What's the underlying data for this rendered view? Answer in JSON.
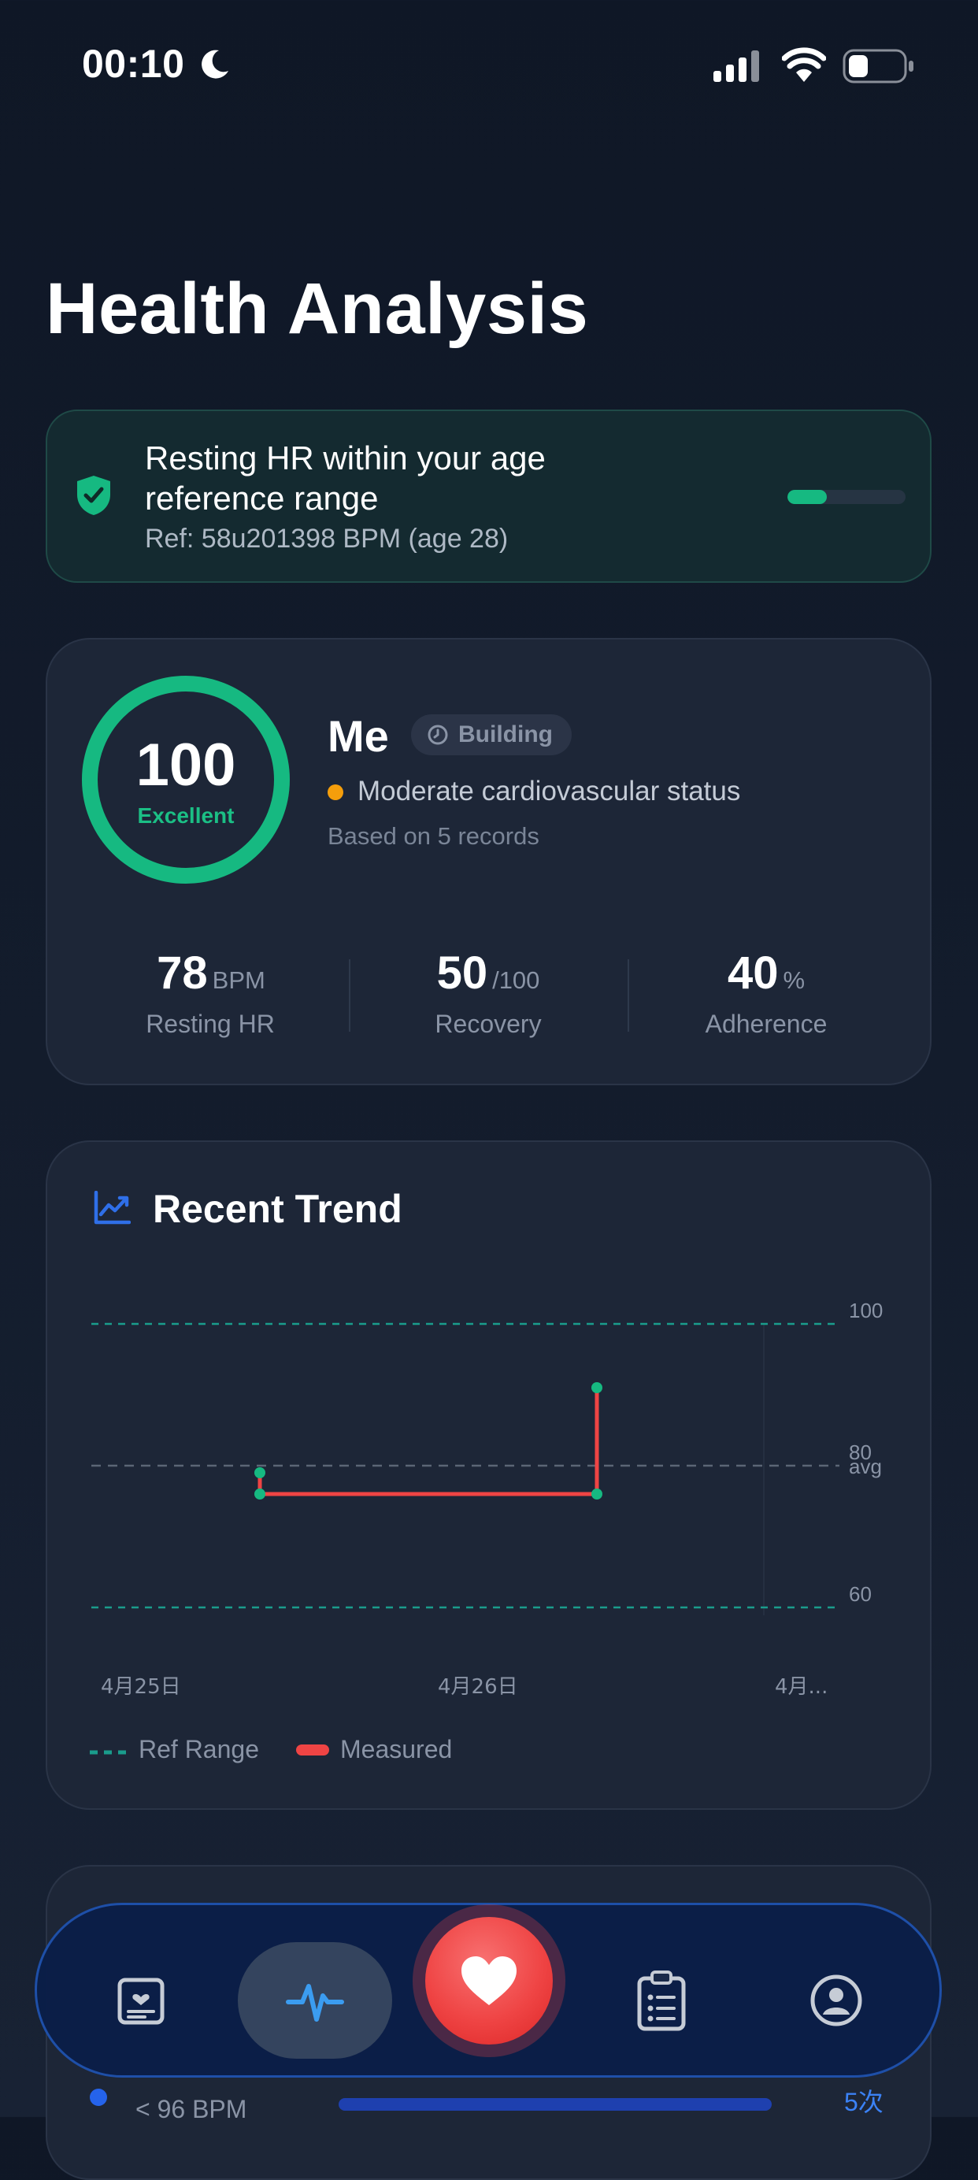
{
  "status_bar": {
    "time": "00:10",
    "moon_icon": "moon-icon",
    "signal_icon": "cellular-signal-icon",
    "wifi_icon": "wifi-icon",
    "battery_icon": "battery-icon"
  },
  "page": {
    "title": "Health Analysis"
  },
  "alert": {
    "icon": "shield-check-icon",
    "title": "Resting HR within your age reference range",
    "ref": "Ref: 58u201398 BPM (age 28)",
    "progress_fraction": 0.33,
    "colors": {
      "accent": "#16b981"
    }
  },
  "score_card": {
    "score": "100",
    "score_fraction": 1.0,
    "score_label": "Excellent",
    "name": "Me",
    "badge": {
      "icon": "clock-icon",
      "label": "Building"
    },
    "status": "Moderate cardiovascular status",
    "status_color": "#f59e0b",
    "records": "Based on 5 records",
    "metrics": [
      {
        "value": "78",
        "unit": "BPM",
        "label": "Resting HR"
      },
      {
        "value": "50",
        "unit": "/100",
        "label": "Recovery"
      },
      {
        "value": "40",
        "unit": "%",
        "label": "Adherence"
      }
    ]
  },
  "trend": {
    "icon": "trend-chart-icon",
    "title": "Recent Trend",
    "legend": {
      "ref": "Ref Range",
      "measured": "Measured"
    }
  },
  "chart_data": {
    "type": "line",
    "title": "",
    "xlabel": "",
    "ylabel": "",
    "ylim": [
      60,
      100
    ],
    "x_ticks": [
      "4月25日",
      "4月26日",
      "4月..."
    ],
    "y_ticks": [
      100,
      80,
      60
    ],
    "avg_label": "avg",
    "avg_value": 80,
    "reference_range": [
      60,
      100
    ],
    "series": [
      {
        "name": "Measured",
        "color": "#ef4444",
        "points": [
          {
            "x": 0.5,
            "y": 79
          },
          {
            "x": 0.5,
            "y": 76
          },
          {
            "x": 1.5,
            "y": 76
          },
          {
            "x": 1.5,
            "y": 91
          }
        ]
      }
    ],
    "colors": {
      "ref": "#1a9c8c",
      "avg": "#5b6575",
      "measured": "#ef4444",
      "point": "#16b981"
    }
  },
  "next_card": {
    "range_text": "< 96 BPM",
    "count_text": "5次"
  },
  "nav": {
    "items": [
      {
        "icon": "health-record-icon"
      },
      {
        "icon": "heartbeat-pulse-icon",
        "active": true
      },
      {
        "icon": "heart-icon"
      },
      {
        "icon": "clipboard-list-icon"
      },
      {
        "icon": "profile-icon"
      }
    ]
  }
}
